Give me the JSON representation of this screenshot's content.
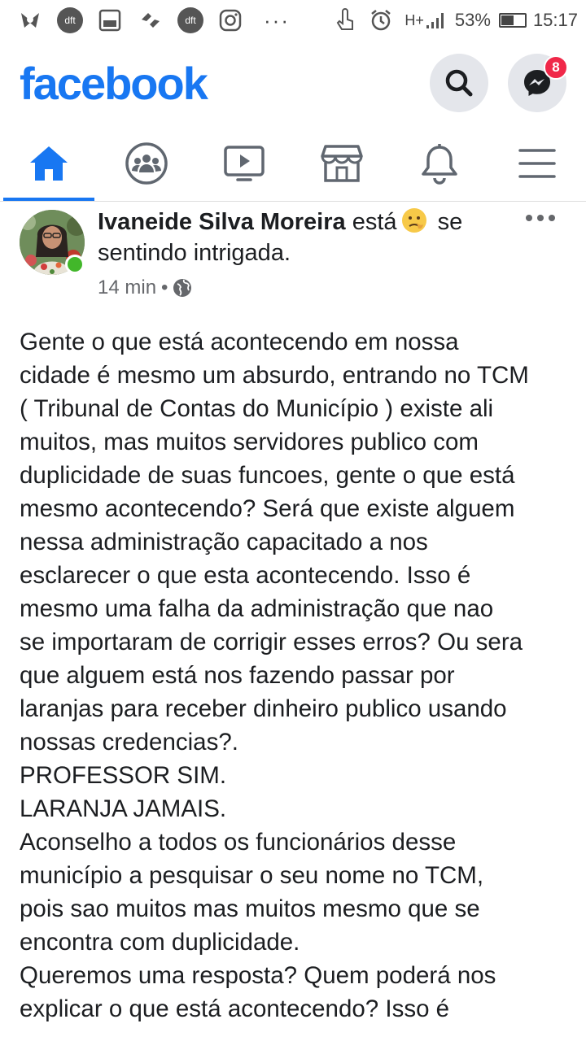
{
  "status_bar": {
    "dft_label": "dft",
    "battery": "53%",
    "time": "15:17",
    "network": "H+",
    "more": "···",
    "battery_level": 0.53
  },
  "header": {
    "logo": "facebook",
    "messenger_badge": "8"
  },
  "nav": {
    "tabs": [
      {
        "name": "home",
        "icon": "home-icon",
        "active": true
      },
      {
        "name": "groups",
        "icon": "groups-icon",
        "active": false
      },
      {
        "name": "watch",
        "icon": "video-icon",
        "active": false
      },
      {
        "name": "marketplace",
        "icon": "store-icon",
        "active": false
      },
      {
        "name": "notifications",
        "icon": "bell-icon",
        "active": false
      },
      {
        "name": "menu",
        "icon": "hamburger-icon",
        "active": false
      }
    ]
  },
  "post": {
    "author": "Ivaneide Silva Moreira",
    "feeling_prefix": "está",
    "feeling_suffix": " se",
    "feeling_line2": "sentindo intrigada.",
    "time": "14 min",
    "separator": "•",
    "body_lines": [
      "Gente o que está acontecendo em nossa",
      "cidade é mesmo um absurdo, entrando no TCM",
      "( Tribunal de Contas do Município ) existe ali",
      "muitos, mas muitos servidores publico com",
      "duplicidade de suas funcoes, gente o que está",
      "mesmo acontecendo? Será que existe alguem",
      "nessa administração capacitado a nos",
      "esclarecer o que esta acontecendo.  Isso é",
      "mesmo uma falha da administração que nao",
      "se importaram de corrigir esses erros? Ou sera",
      "que alguem está nos fazendo passar por",
      "laranjas para receber dinheiro publico usando",
      "nossas credencias?.",
      "PROFESSOR SIM.",
      "LARANJA JAMAIS.",
      "Aconselho a todos os funcionários desse",
      "município a pesquisar o seu nome no TCM,",
      "pois sao muitos mas muitos mesmo que se",
      "encontra com duplicidade.",
      "Queremos uma resposta? Quem poderá nos",
      "explicar o que está acontecendo? Isso   é"
    ]
  },
  "colors": {
    "brand": "#1877f2",
    "badge": "#f02849",
    "online": "#42b72a",
    "secondary_text": "#65676b"
  }
}
